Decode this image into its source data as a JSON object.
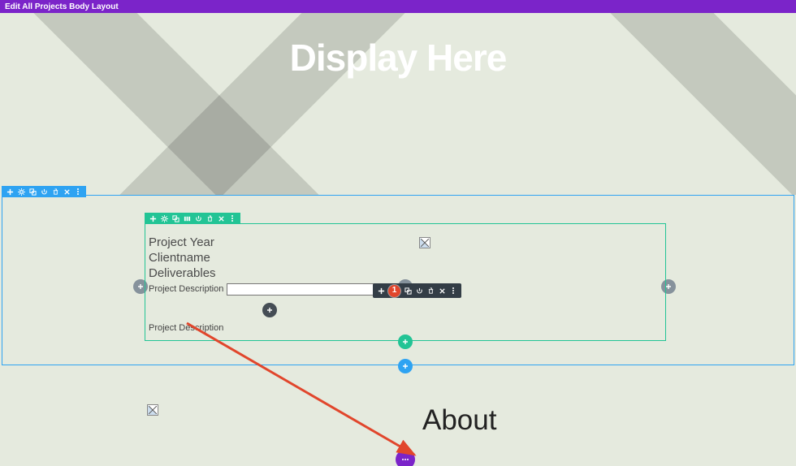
{
  "topbar": {
    "title": "Edit All Projects Body Layout"
  },
  "hero": {
    "heading": "Display Here"
  },
  "row": {
    "project_year": "Project Year",
    "clientname": "Clientname",
    "deliverables": "Deliverables",
    "project_description_label": "Project Description",
    "project_description_text": "Project Description",
    "desc_value": ""
  },
  "badge": {
    "number": "1"
  },
  "about": {
    "heading": "About"
  },
  "icons": {
    "plus": "plus",
    "gear": "gear",
    "dup": "duplicate",
    "cols": "columns",
    "power": "power",
    "trash": "trash",
    "close": "close",
    "dots": "dots"
  }
}
